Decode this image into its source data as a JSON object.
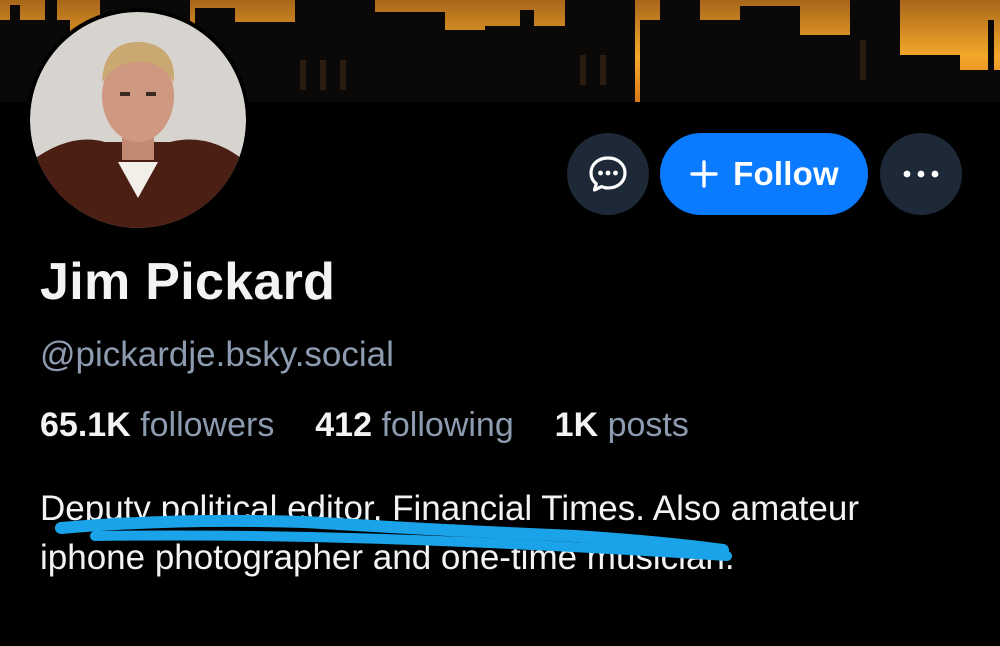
{
  "banner": {
    "sky_top": "#7a4a12",
    "sky_glow": "#f6b129",
    "skyline_color": "#0a0908"
  },
  "profile": {
    "display_name": "Jim Pickard",
    "handle": "@pickardje.bsky.social",
    "avatar_icon": "profile-photo"
  },
  "actions": {
    "message_icon": "chat-bubble-icon",
    "follow_label": "Follow",
    "follow_icon": "plus-icon",
    "more_icon": "ellipsis-icon"
  },
  "stats": {
    "followers_count": "65.1K",
    "followers_label": "followers",
    "following_count": "412",
    "following_label": "following",
    "posts_count": "1K",
    "posts_label": "posts"
  },
  "bio": {
    "text": "Deputy political editor, Financial Times. Also amateur iphone photographer and one-time musician.",
    "redaction_color": "#1aa3e8"
  },
  "colors": {
    "background": "#000000",
    "accent": "#0a7aff",
    "muted_text": "#8d9bb0",
    "button_dark": "#1e2937"
  }
}
